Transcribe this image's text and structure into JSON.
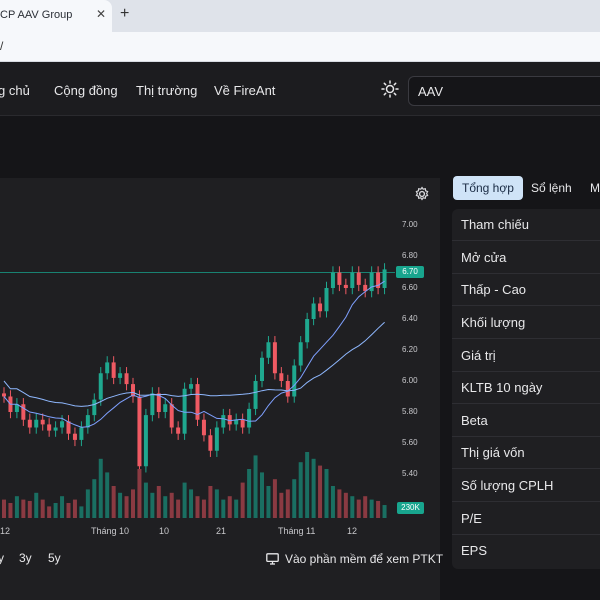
{
  "browser": {
    "tab_title": "CP AAV Group",
    "tab_close": "✕",
    "new_tab": "+",
    "url_fragment": "/"
  },
  "nav": {
    "items": [
      "g chủ",
      "Cộng đồng",
      "Thị trường",
      "Về FireAnt"
    ],
    "search_value": "AAV"
  },
  "chart": {
    "price_ticks": [
      "7.00",
      "6.80",
      "6.60",
      "6.40",
      "6.20",
      "6.00",
      "5.80",
      "5.60",
      "5.40"
    ],
    "current_price": "6.70",
    "volume_tag": "230K",
    "x_ticks": [
      "12",
      "Tháng 10",
      "10",
      "21",
      "Tháng 11",
      "12"
    ],
    "ranges": [
      "y",
      "3y",
      "5y"
    ],
    "ptkt_label": "Vào phần mềm để xem PTKT",
    "colors": {
      "up": "#1fa88f",
      "down": "#ef5a63",
      "ma_short": "#7fa0ff",
      "ma_long": "#8fb8ff"
    }
  },
  "sidebar": {
    "tabs": [
      "Tổng hợp",
      "Sổ lệnh",
      "M"
    ],
    "stats": [
      "Tham chiếu",
      "Mở cửa",
      "Thấp - Cao",
      "Khối lượng",
      "Giá trị",
      "KLTB 10 ngày",
      "Beta",
      "Thị giá vốn",
      "Số lượng CPLH",
      "P/E",
      "EPS"
    ]
  },
  "icons": [
    "close-icon",
    "plus-icon",
    "sun-icon",
    "gear-icon",
    "monitor-icon"
  ]
}
